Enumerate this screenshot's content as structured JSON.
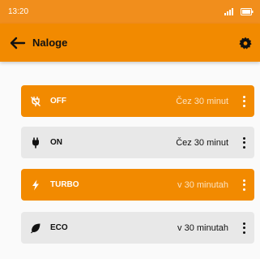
{
  "status_bar": {
    "time": "13:20",
    "signal_icon": "signal-icon",
    "battery_icon": "battery-icon"
  },
  "app_bar": {
    "title": "Naloge",
    "back_icon": "arrow-left-icon",
    "settings_icon": "gear-icon"
  },
  "colors": {
    "accent": "#f28a00",
    "status_bar": "#f18e1c",
    "inactive_card": "#e8e8e8"
  },
  "tasks": [
    {
      "name": "OFF",
      "when": "Čez 30 minut",
      "icon": "plug-off-icon",
      "active": true
    },
    {
      "name": "ON",
      "when": "Čez 30 minut",
      "icon": "plug-icon",
      "active": false
    },
    {
      "name": "TURBO",
      "when": "v 30 minutah",
      "icon": "lightning-icon",
      "active": true
    },
    {
      "name": "ECO",
      "when": "v 30 minutah",
      "icon": "leaf-icon",
      "active": false
    }
  ]
}
